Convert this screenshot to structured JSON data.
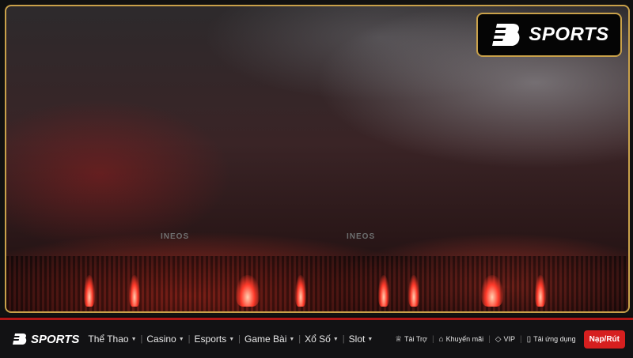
{
  "brand": {
    "name": "SPORTS",
    "accent": "#c9a14a",
    "nav_bar_color": "#b01616"
  },
  "photo": {
    "signage": [
      "INEOS",
      "INEOS"
    ]
  },
  "nav": {
    "menu": [
      {
        "label": "Thể Thao",
        "has_dropdown": true
      },
      {
        "label": "Casino",
        "has_dropdown": true
      },
      {
        "label": "Esports",
        "has_dropdown": true
      },
      {
        "label": "Game Bài",
        "has_dropdown": true
      },
      {
        "label": "Xổ Số",
        "has_dropdown": true
      },
      {
        "label": "Slot",
        "has_dropdown": true
      }
    ],
    "utilities": [
      {
        "label": "Tài Trợ",
        "icon": "trophy-icon"
      },
      {
        "label": "Khuyến mãi",
        "icon": "tag-icon"
      },
      {
        "label": "VIP",
        "icon": "diamond-icon"
      },
      {
        "label": "Tải ứng dụng",
        "icon": "phone-icon"
      }
    ],
    "deposit_label": "Nạp/Rút",
    "deposit_color": "#d61f1f"
  }
}
